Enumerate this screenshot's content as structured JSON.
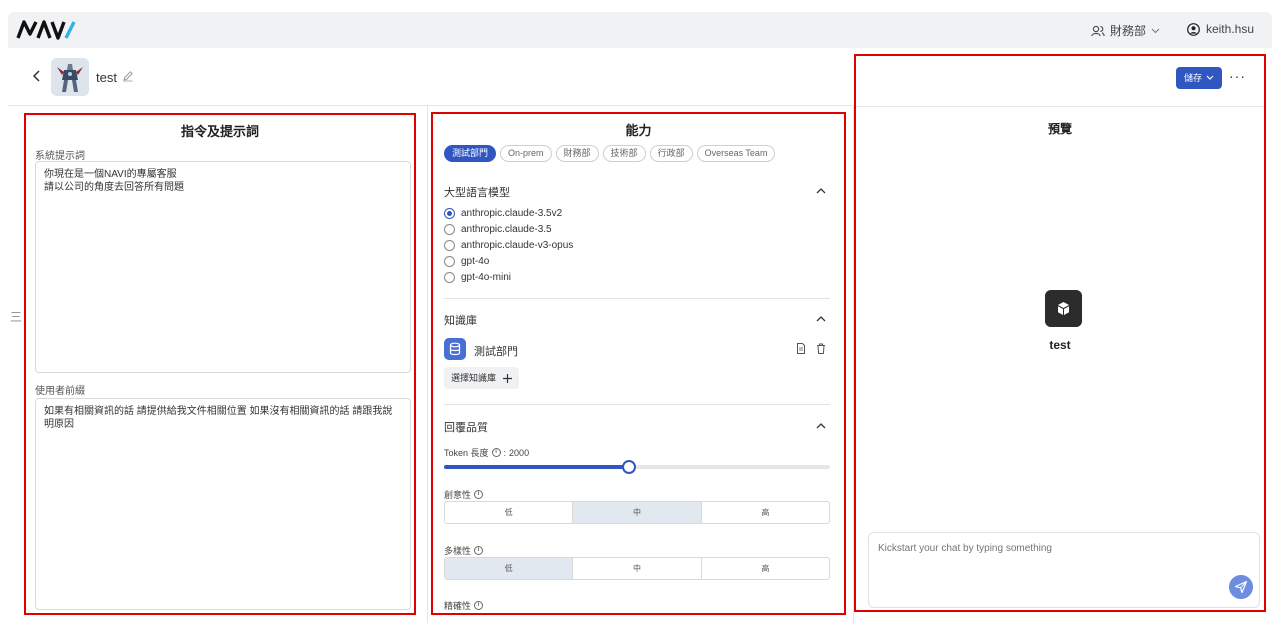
{
  "header": {
    "logo_text": "NAVI",
    "department": "財務部",
    "username": "keith.hsu"
  },
  "bot": {
    "name": "test"
  },
  "sidebar_grip": "三",
  "left_panel": {
    "title": "指令及提示詞",
    "system_prompt_label": "系統提示詞",
    "system_prompt_value": "你現在是一個NAVI的專屬客服\n請以公司的角度去回答所有問題",
    "user_prefix_label": "使用者前綴",
    "user_prefix_value": "如果有相關資訊的話 請提供給我文件相關位置 如果沒有相關資訊的話 請跟我說明原因"
  },
  "mid_panel": {
    "title": "能力",
    "departments": [
      "測試部門",
      "On-prem",
      "財務部",
      "技術部",
      "行政部",
      "Overseas Team"
    ],
    "active_department": "測試部門",
    "llm_section": "大型語言模型",
    "models": [
      "anthropic.claude-3.5v2",
      "anthropic.claude-3.5",
      "anthropic.claude-v3-opus",
      "gpt-4o",
      "gpt-4o-mini"
    ],
    "selected_model": "anthropic.claude-3.5v2",
    "kb_section": "知識庫",
    "kb_item": "測試部門",
    "kb_add_label": "選擇知識庫",
    "quality_section": "回覆品質",
    "token_label": "Token 長度",
    "token_value": "2000",
    "token_fraction": 0.48,
    "creativity_label": "創意性",
    "diversity_label": "多樣性",
    "precision_label": "精確性",
    "levels": [
      "低",
      "中",
      "高"
    ],
    "creativity_selected": "中",
    "diversity_selected": "低"
  },
  "right_panel": {
    "save_label": "儲存",
    "more_label": "···",
    "title": "預覽",
    "bot_title": "test",
    "chat_placeholder": "Kickstart your chat by typing something"
  },
  "colors": {
    "accent": "#2f56c1",
    "highlight": "#e00000"
  }
}
